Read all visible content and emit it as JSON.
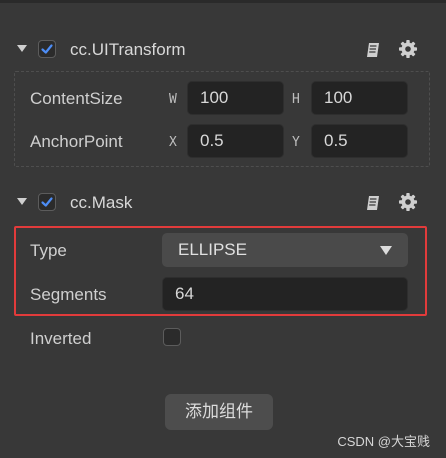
{
  "components": {
    "uitransform": {
      "title": "cc.UITransform",
      "enabled": true,
      "content_size": {
        "label": "ContentSize",
        "w_axis": "W",
        "w_value": "100",
        "h_axis": "H",
        "h_value": "100"
      },
      "anchor_point": {
        "label": "AnchorPoint",
        "x_axis": "X",
        "x_value": "0.5",
        "y_axis": "Y",
        "y_value": "0.5"
      }
    },
    "mask": {
      "title": "cc.Mask",
      "enabled": true,
      "type": {
        "label": "Type",
        "value": "ELLIPSE"
      },
      "segments": {
        "label": "Segments",
        "value": "64"
      },
      "inverted": {
        "label": "Inverted",
        "checked": false
      }
    }
  },
  "add_component_label": "添加组件",
  "watermark": "CSDN @大宝贱",
  "colors": {
    "highlight": "#e23b3b",
    "check": "#4d8df6"
  },
  "icons": {
    "collapse": "triangle-down",
    "doc": "book-icon",
    "settings": "gear-icon"
  }
}
